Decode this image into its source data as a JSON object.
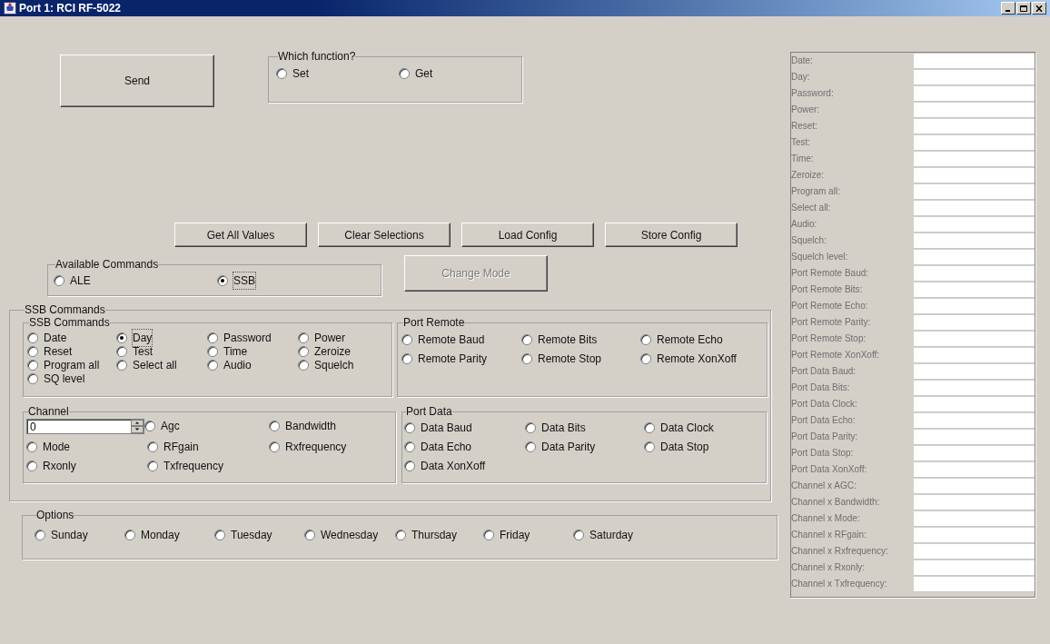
{
  "window": {
    "title": "Port 1: RCI RF-5022"
  },
  "send_button": {
    "label": "Send"
  },
  "which_function": {
    "legend": "Which function?",
    "options": [
      {
        "label": "Set",
        "selected": false
      },
      {
        "label": "Get",
        "selected": false
      }
    ]
  },
  "action_buttons": [
    {
      "label": "Get All Values"
    },
    {
      "label": "Clear Selections"
    },
    {
      "label": "Load Config"
    },
    {
      "label": "Store Config"
    }
  ],
  "available_commands": {
    "legend": "Available Commands",
    "options": [
      {
        "label": "ALE",
        "selected": false
      },
      {
        "label": "SSB",
        "selected": true
      }
    ]
  },
  "change_mode": {
    "label": "Change Mode",
    "disabled": true
  },
  "ssb_commands": {
    "legend": "SSB Commands",
    "commands": {
      "legend": "SSB Commands",
      "options": [
        {
          "label": "Date",
          "selected": false
        },
        {
          "label": "Day",
          "selected": true
        },
        {
          "label": "Password",
          "selected": false
        },
        {
          "label": "Power",
          "selected": false
        },
        {
          "label": "Reset",
          "selected": false
        },
        {
          "label": "Test",
          "selected": false
        },
        {
          "label": "Time",
          "selected": false
        },
        {
          "label": "Zeroize",
          "selected": false
        },
        {
          "label": "Program all",
          "selected": false
        },
        {
          "label": "Select all",
          "selected": false
        },
        {
          "label": "Audio",
          "selected": false
        },
        {
          "label": "Squelch",
          "selected": false
        },
        {
          "label": "SQ level",
          "selected": false
        }
      ]
    },
    "port_remote": {
      "legend": "Port Remote",
      "options": [
        {
          "label": "Remote Baud",
          "selected": false
        },
        {
          "label": "Remote Bits",
          "selected": false
        },
        {
          "label": "Remote Echo",
          "selected": false
        },
        {
          "label": "Remote Parity",
          "selected": false
        },
        {
          "label": "Remote Stop",
          "selected": false
        },
        {
          "label": "Remote XonXoff",
          "selected": false
        }
      ]
    },
    "channel": {
      "legend": "Channel",
      "spinner": {
        "value": "0"
      },
      "options": [
        {
          "label": "Agc",
          "selected": false
        },
        {
          "label": "Bandwidth",
          "selected": false
        },
        {
          "label": "Mode",
          "selected": false
        },
        {
          "label": "RFgain",
          "selected": false
        },
        {
          "label": "Rxfrequency",
          "selected": false
        },
        {
          "label": "Rxonly",
          "selected": false
        },
        {
          "label": "Txfrequency",
          "selected": false
        }
      ]
    },
    "port_data": {
      "legend": "Port Data",
      "options": [
        {
          "label": "Data Baud",
          "selected": false
        },
        {
          "label": "Data Bits",
          "selected": false
        },
        {
          "label": "Data Clock",
          "selected": false
        },
        {
          "label": "Data Echo",
          "selected": false
        },
        {
          "label": "Data Parity",
          "selected": false
        },
        {
          "label": "Data Stop",
          "selected": false
        },
        {
          "label": "Data XonXoff",
          "selected": false
        }
      ]
    }
  },
  "options": {
    "legend": "Options",
    "options": [
      {
        "label": "Sunday",
        "selected": false
      },
      {
        "label": "Monday",
        "selected": false
      },
      {
        "label": "Tuesday",
        "selected": false
      },
      {
        "label": "Wednesday",
        "selected": false
      },
      {
        "label": "Thursday",
        "selected": false
      },
      {
        "label": "Friday",
        "selected": false
      },
      {
        "label": "Saturday",
        "selected": false
      }
    ]
  },
  "results": {
    "disabled": true,
    "rows": [
      {
        "label": "Date:"
      },
      {
        "label": "Day:"
      },
      {
        "label": "Password:"
      },
      {
        "label": "Power:"
      },
      {
        "label": "Reset:"
      },
      {
        "label": "Test:"
      },
      {
        "label": "Time:"
      },
      {
        "label": "Zeroize:"
      },
      {
        "label": "Program all:"
      },
      {
        "label": "Select all:"
      },
      {
        "label": "Audio:"
      },
      {
        "label": "Squelch:"
      },
      {
        "label": "Squelch level:"
      },
      {
        "label": "Port Remote Baud:"
      },
      {
        "label": "Port Remote Bits:"
      },
      {
        "label": "Port Remote Echo:"
      },
      {
        "label": "Port Remote Parity:"
      },
      {
        "label": "Port Remote Stop:"
      },
      {
        "label": "Port Remote XonXoff:"
      },
      {
        "label": "Port Data Baud:"
      },
      {
        "label": "Port Data Bits:"
      },
      {
        "label": "Port Data Clock:"
      },
      {
        "label": "Port Data Echo:"
      },
      {
        "label": "Port Data Parity:"
      },
      {
        "label": "Port Data Stop:"
      },
      {
        "label": "Port Data XonXoff:"
      },
      {
        "label": "Channel x AGC:"
      },
      {
        "label": "Channel x Bandwidth:"
      },
      {
        "label": "Channel x Mode:"
      },
      {
        "label": "Channel x RFgain:"
      },
      {
        "label": "Channel x Rxfrequency:"
      },
      {
        "label": "Channel x Rxonly:"
      },
      {
        "label": "Channel x Txfrequency:"
      }
    ]
  }
}
